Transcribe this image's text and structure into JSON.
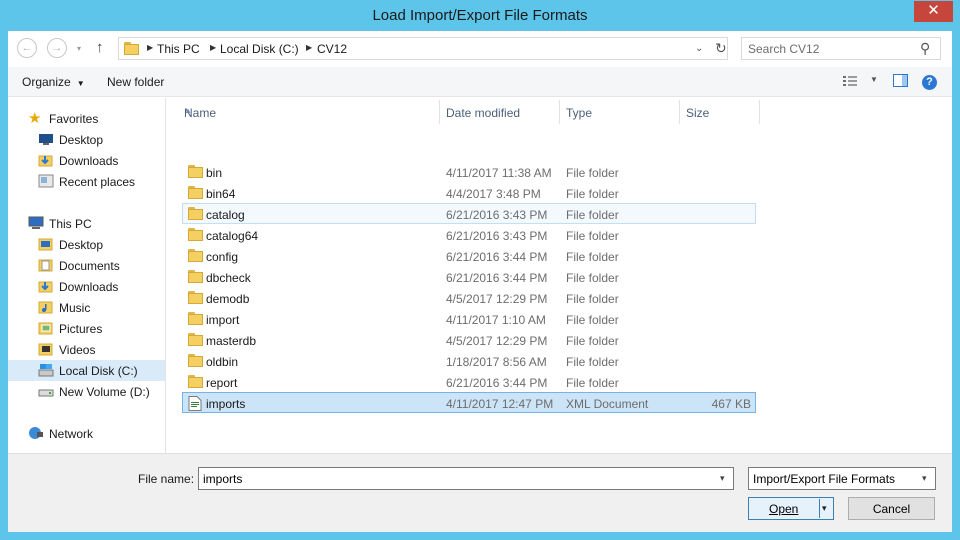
{
  "window": {
    "title": "Load Import/Export File Formats",
    "close_glyph": "✕"
  },
  "nav": {
    "back_glyph": "←",
    "forward_glyph": "→",
    "recent_glyph": "▾",
    "up_glyph": "↑",
    "breadcrumb": [
      "This PC",
      "Local Disk (C:)",
      "CV12"
    ],
    "crumb_sep": "▶",
    "address_dropdown_glyph": "⌄",
    "refresh_glyph": "↻",
    "search_placeholder": "Search CV12",
    "search_glyph": "⚲"
  },
  "toolbar": {
    "organize": "Organize",
    "organize_caret": "▼",
    "new_folder": "New folder",
    "view_caret": "▼",
    "help": "?"
  },
  "sidebar": {
    "favorites": [
      {
        "label": "Favorites",
        "icon": "star-icon"
      },
      {
        "label": "Desktop",
        "icon": "desktop-icon"
      },
      {
        "label": "Downloads",
        "icon": "downloads-icon"
      },
      {
        "label": "Recent places",
        "icon": "recent-places-icon"
      }
    ],
    "this_pc": [
      {
        "label": "This PC",
        "icon": "computer-icon"
      },
      {
        "label": "Desktop",
        "icon": "desktop-folder-icon"
      },
      {
        "label": "Documents",
        "icon": "documents-icon"
      },
      {
        "label": "Downloads",
        "icon": "downloads-icon"
      },
      {
        "label": "Music",
        "icon": "music-icon"
      },
      {
        "label": "Pictures",
        "icon": "pictures-icon"
      },
      {
        "label": "Videos",
        "icon": "videos-icon"
      },
      {
        "label": "Local Disk (C:)",
        "icon": "local-disk-icon"
      },
      {
        "label": "New Volume (D:)",
        "icon": "drive-icon"
      }
    ],
    "network": {
      "label": "Network",
      "icon": "network-icon"
    }
  },
  "columns": [
    "Name",
    "Date modified",
    "Type",
    "Size"
  ],
  "files": [
    {
      "name": "bin",
      "date": "4/11/2017 11:38 AM",
      "type": "File folder",
      "size": ""
    },
    {
      "name": "bin64",
      "date": "4/4/2017 3:48 PM",
      "type": "File folder",
      "size": ""
    },
    {
      "name": "catalog",
      "date": "6/21/2016 3:43 PM",
      "type": "File folder",
      "size": ""
    },
    {
      "name": "catalog64",
      "date": "6/21/2016 3:43 PM",
      "type": "File folder",
      "size": ""
    },
    {
      "name": "config",
      "date": "6/21/2016 3:44 PM",
      "type": "File folder",
      "size": ""
    },
    {
      "name": "dbcheck",
      "date": "6/21/2016 3:44 PM",
      "type": "File folder",
      "size": ""
    },
    {
      "name": "demodb",
      "date": "4/5/2017 12:29 PM",
      "type": "File folder",
      "size": ""
    },
    {
      "name": "import",
      "date": "4/11/2017 1:10 AM",
      "type": "File folder",
      "size": ""
    },
    {
      "name": "masterdb",
      "date": "4/5/2017 12:29 PM",
      "type": "File folder",
      "size": ""
    },
    {
      "name": "oldbin",
      "date": "1/18/2017 8:56 AM",
      "type": "File folder",
      "size": ""
    },
    {
      "name": "report",
      "date": "6/21/2016 3:44 PM",
      "type": "File folder",
      "size": ""
    },
    {
      "name": "imports",
      "date": "4/11/2017 12:47 PM",
      "type": "XML Document",
      "size": "467 KB"
    }
  ],
  "footer": {
    "file_name_label": "File name:",
    "file_name_value": "imports",
    "file_type": "Import/Export File Formats",
    "dropdown_glyph": "▾",
    "open": "Open",
    "open_split_glyph": "▾",
    "cancel": "Cancel"
  }
}
